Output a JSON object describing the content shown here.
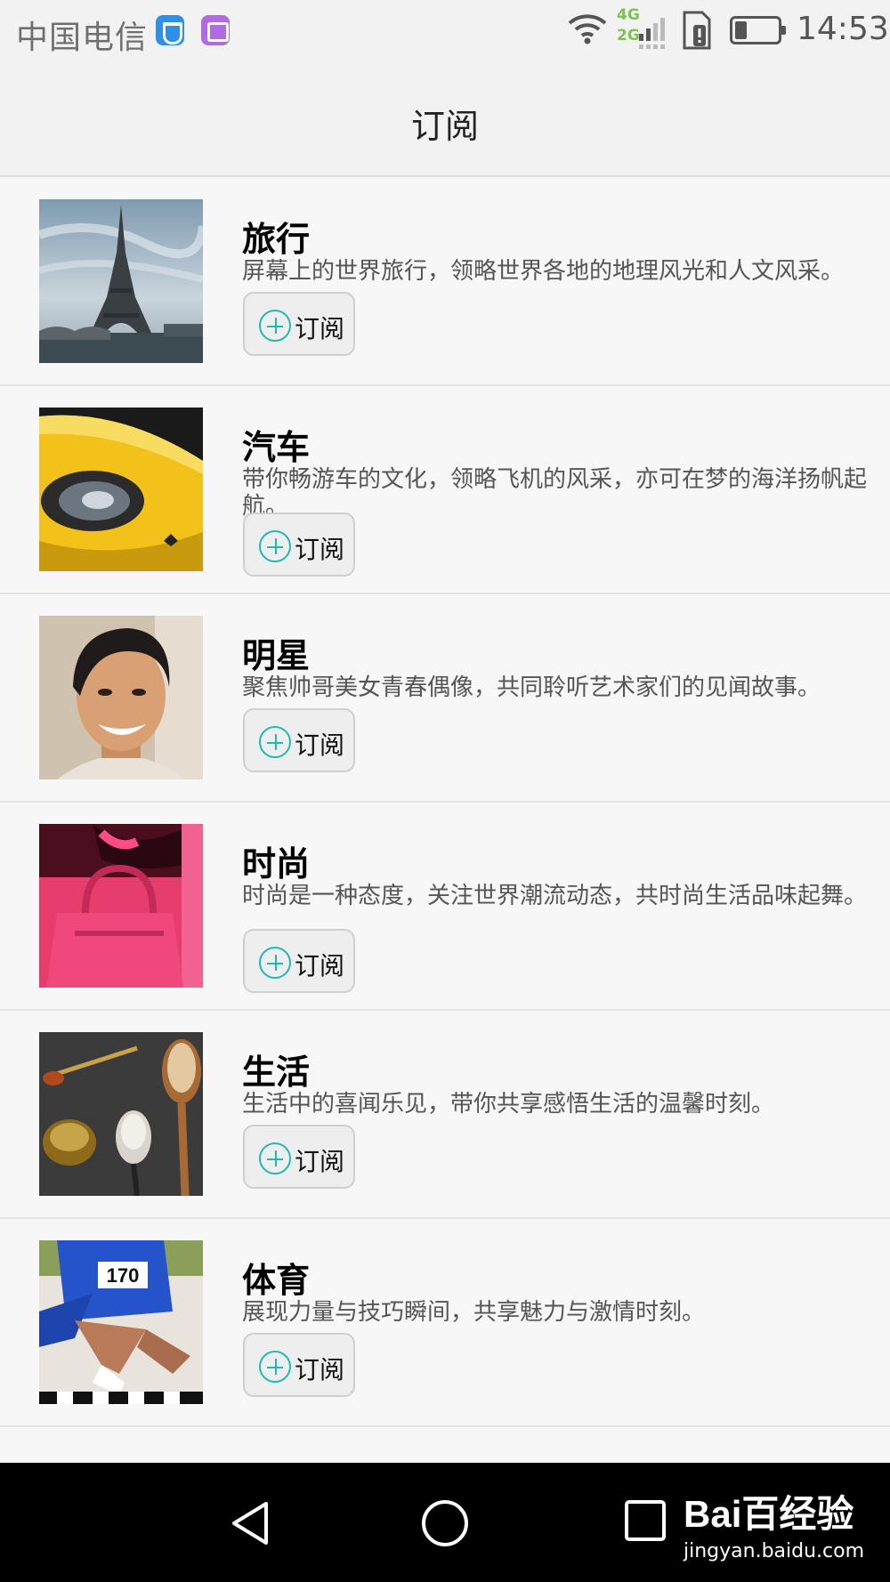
{
  "status_bar": {
    "carrier": "中国电信",
    "network_4g": "4G",
    "network_2g": "2G",
    "time": "14:53"
  },
  "header": {
    "title": "订阅"
  },
  "subscribe_label": "订阅",
  "items": [
    {
      "title": "旅行",
      "description": "屏幕上的世界旅行，领略世界各地的地理风光和人文风采。"
    },
    {
      "title": "汽车",
      "description": "带你畅游车的文化，领略飞机的风采，亦可在梦的海洋扬帆起航。"
    },
    {
      "title": "明星",
      "description": "聚焦帅哥美女青春偶像，共同聆听艺术家们的见闻故事。"
    },
    {
      "title": "时尚",
      "description": "时尚是一种态度，关注世界潮流动态，共时尚生活品味起舞。"
    },
    {
      "title": "生活",
      "description": "生活中的喜闻乐见，带你共享感悟生活的温馨时刻。"
    },
    {
      "title": "体育",
      "description": "展现力量与技巧瞬间，共享魅力与激情时刻。"
    }
  ],
  "thumb_text": {
    "bib_number": "170"
  },
  "watermark": {
    "logo": "Bai百经验",
    "url": "jingyan.baidu.com"
  },
  "colors": {
    "accent": "#1fb8b2",
    "background": "#f7f7f7",
    "nav_bar": "#000000"
  }
}
